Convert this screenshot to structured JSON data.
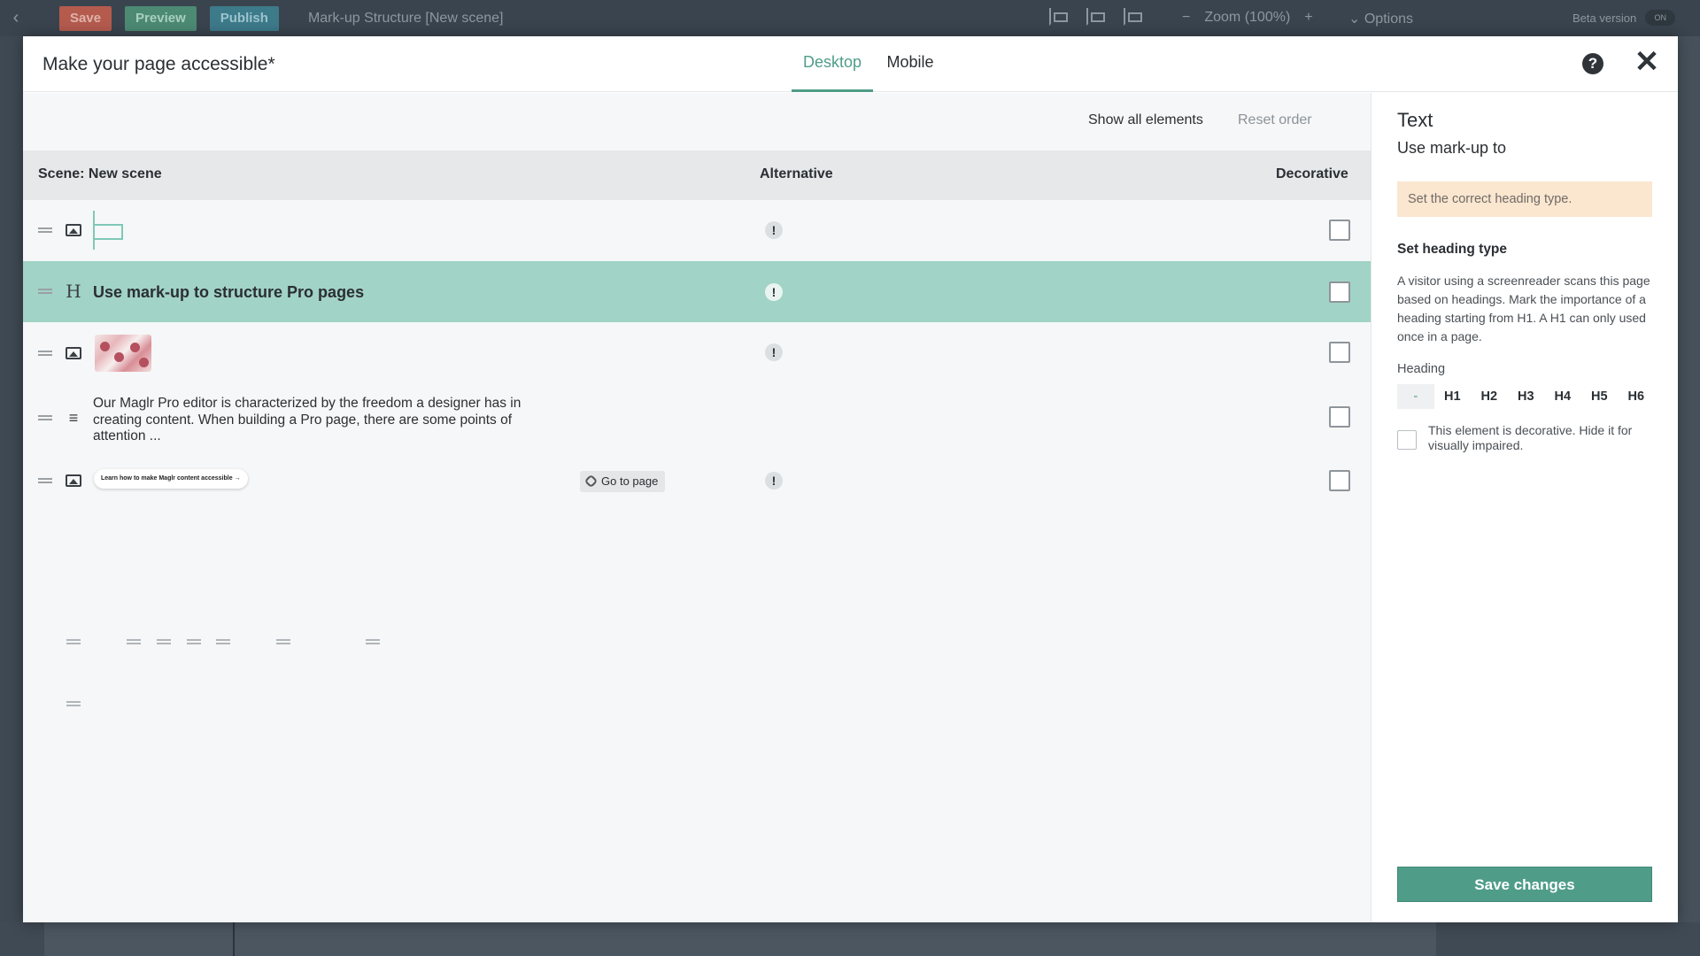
{
  "editor": {
    "save_label": "Save",
    "preview_label": "Preview",
    "publish_label": "Publish",
    "document_title": "Mark-up Structure [New scene]",
    "zoom_label": "Zoom (100%)",
    "options_label": "Options",
    "beta_label": "Beta version",
    "toggle_label": "ON"
  },
  "modal": {
    "title": "Make your page accessible*",
    "tabs": [
      {
        "label": "Desktop",
        "active": true
      },
      {
        "label": "Mobile",
        "active": false
      }
    ],
    "help_icon": "question-circle-icon",
    "close_icon": "close-icon"
  },
  "toolbar": {
    "show_all": "Show all elements",
    "reset_order": "Reset order"
  },
  "table": {
    "columns": {
      "scene": "Scene: New scene",
      "alternative": "Alternative",
      "decorative": "Decorative"
    },
    "rows": [
      {
        "type": "image",
        "icon": "image-icon",
        "preview": "shape",
        "warning": "!",
        "decorative": false
      },
      {
        "type": "heading",
        "icon": "heading-icon",
        "text": "Use mark-up to structure Pro pages",
        "warning": "!",
        "decorative": false,
        "selected": true
      },
      {
        "type": "image",
        "icon": "image-icon",
        "preview": "photo",
        "warning": "!",
        "decorative": false
      },
      {
        "type": "text",
        "icon": "paragraph-icon",
        "text": "Our Maglr Pro editor is characterized by the freedom a designer has in creating content. When building a Pro page, there are some points of attention ...",
        "decorative": false
      },
      {
        "type": "link-image",
        "icon": "image-link-icon",
        "pill_text": "Learn how to make Maglr content accessible",
        "goto_label": "Go to page",
        "warning": "!",
        "decorative": false
      }
    ]
  },
  "panel": {
    "title": "Text",
    "subtitle": "Use mark-up to",
    "warning": "Set the correct heading type.",
    "section_title": "Set heading type",
    "description": "A visitor using a screenreader scans this page based on headings. Mark the importance of a heading starting from H1. A H1 can only used once in a page.",
    "heading_label": "Heading",
    "heading_options": [
      "-",
      "H1",
      "H2",
      "H3",
      "H4",
      "H5",
      "H6"
    ],
    "heading_selected": "-",
    "decorative_text": "This element is decorative. Hide it for visually impaired.",
    "save_label": "Save changes"
  },
  "colors": {
    "accent": "#4f9d89",
    "selected_row": "#a1d3c6",
    "warning_bg": "#fbe6d0"
  }
}
